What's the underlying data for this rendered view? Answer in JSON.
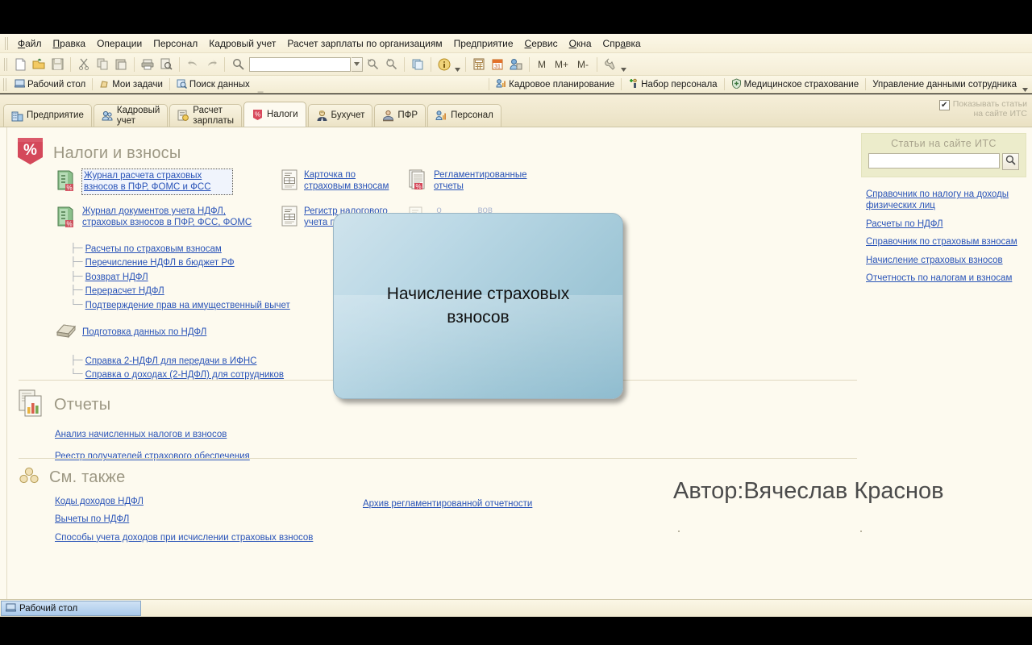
{
  "menubar": {
    "items": [
      {
        "label": "Файл",
        "accel": "Ф"
      },
      {
        "label": "Правка",
        "accel": "П"
      },
      {
        "label": "Операции",
        "accel": ""
      },
      {
        "label": "Персонал",
        "accel": ""
      },
      {
        "label": "Кадровый учет",
        "accel": ""
      },
      {
        "label": "Расчет зарплаты по организациям",
        "accel": ""
      },
      {
        "label": "Предприятие",
        "accel": ""
      },
      {
        "label": "Сервис",
        "accel": "С"
      },
      {
        "label": "Окна",
        "accel": "О"
      },
      {
        "label": "Справка",
        "accel": "а"
      }
    ]
  },
  "toolbar": {
    "search_value": "",
    "search_placeholder": "",
    "memory_buttons": [
      "M",
      "M+",
      "M-"
    ],
    "icons": [
      "new-document-icon",
      "open-folder-icon",
      "save-icon",
      "cut-icon",
      "copy-icon",
      "paste-icon",
      "print-icon",
      "print-preview-icon",
      "undo-icon",
      "redo-icon",
      "find-icon",
      "find-next-icon",
      "find-cancel-icon",
      "copy-window-icon",
      "info-icon",
      "calculator-icon",
      "calendar-icon",
      "user-settings-icon",
      "tools-icon"
    ]
  },
  "favorites": {
    "left_items": [
      {
        "label": "Рабочий стол",
        "icon": "desktop-icon"
      },
      {
        "label": "Мои задачи",
        "icon": "tasks-icon"
      },
      {
        "label": "Поиск данных",
        "icon": "search-data-icon"
      }
    ],
    "right_items": [
      {
        "label": "Кадровое планирование",
        "icon": "hr-planning-icon"
      },
      {
        "label": "Набор персонала",
        "icon": "recruiting-icon"
      },
      {
        "label": "Медицинское страхование",
        "icon": "medical-insurance-icon"
      },
      {
        "label": "Управление данными сотрудника",
        "icon": "employee-data-icon"
      }
    ]
  },
  "tabs": [
    {
      "label": "Предприятие",
      "icon": "enterprise-icon",
      "active": false,
      "line2": ""
    },
    {
      "label": "Кадровый",
      "line2": "учет",
      "icon": "hr-icon",
      "active": false
    },
    {
      "label": "Расчет",
      "line2": "зарплаты",
      "icon": "payroll-icon",
      "active": false
    },
    {
      "label": "Налоги",
      "line2": "",
      "icon": "taxes-icon",
      "active": true
    },
    {
      "label": "Бухучет",
      "line2": "",
      "icon": "accounting-icon",
      "active": false
    },
    {
      "label": "ПФР",
      "line2": "",
      "icon": "pfr-icon",
      "active": false
    },
    {
      "label": "Персонал",
      "line2": "",
      "icon": "personnel-icon",
      "active": false
    }
  ],
  "its_checkbox": {
    "line1": "Показывать статьи",
    "line2": "на сайте ИТС",
    "checked": true
  },
  "main": {
    "title": "Налоги и взносы",
    "title_icon": "percent-shield-icon",
    "col1": {
      "journal1": "Журнал расчета страховых взносов в ПФР, ФОМС и ФСС",
      "journal2": "Журнал документов учета НДФЛ, страховых взносов в ПФР, ФСС, ФОМС",
      "tree1": [
        "Расчеты по страховым взносам",
        "Перечисление НДФЛ в бюджет РФ",
        "Возврат НДФЛ",
        "Перерасчет НДФЛ",
        "Подтверждение прав на имущественный вычет"
      ],
      "prep": "Подготовка данных по НДФЛ",
      "tree2": [
        "Справка 2-НДФЛ для передачи в ИФНС",
        "Справка о доходах (2-НДФЛ) для сотрудников"
      ]
    },
    "col2": [
      {
        "label": "Карточка по страховым взносам",
        "icon": "register-card-icon"
      },
      {
        "label": "Регистр налогового учета по доходы",
        "icon": "register-card-icon"
      }
    ],
    "col3": [
      {
        "label": "Регламентированные отчеты",
        "icon": "reports-percent-icon"
      }
    ]
  },
  "reports": {
    "title": "Отчеты",
    "icon": "reports-chart-icon",
    "links": [
      "Анализ начисленных налогов и взносов",
      "Реестр получателей страхового обеспечения"
    ]
  },
  "see_also": {
    "title": "См. также",
    "icon": "see-also-icon",
    "left_links": [
      "Коды доходов НДФЛ",
      "Вычеты по НДФЛ",
      "Способы учета доходов при исчислении страховых взносов"
    ],
    "right_links": [
      "Архив регламентированной отчетности"
    ]
  },
  "its_panel": {
    "title": "Статьи на сайте ИТС",
    "search_value": "",
    "search_placeholder": "",
    "search_icon": "magnifier-icon",
    "links": [
      "Справочник по налогу на доходы физических лиц",
      "Расчеты по НДФЛ",
      "Справочник по страховым взносам",
      "Начисление страховых взносов",
      "Отчетность по налогам и взносам"
    ]
  },
  "overlay": {
    "text": "Начисление страховых взносов"
  },
  "author": "Автор:Вячеслав Краснов",
  "taskbar": {
    "button_label": "Рабочий стол",
    "button_icon": "desktop-icon"
  },
  "colors": {
    "link": "#2a54b8",
    "heading": "#9d9884",
    "content_bg": "#fdfaef",
    "chrome_bg": "#f6efd8",
    "its_panel_bg": "#ececcb",
    "overlay_top": "#cfe3ec",
    "overlay_bottom": "#8fbccf",
    "taskbar_active": "#a9c9ea"
  }
}
